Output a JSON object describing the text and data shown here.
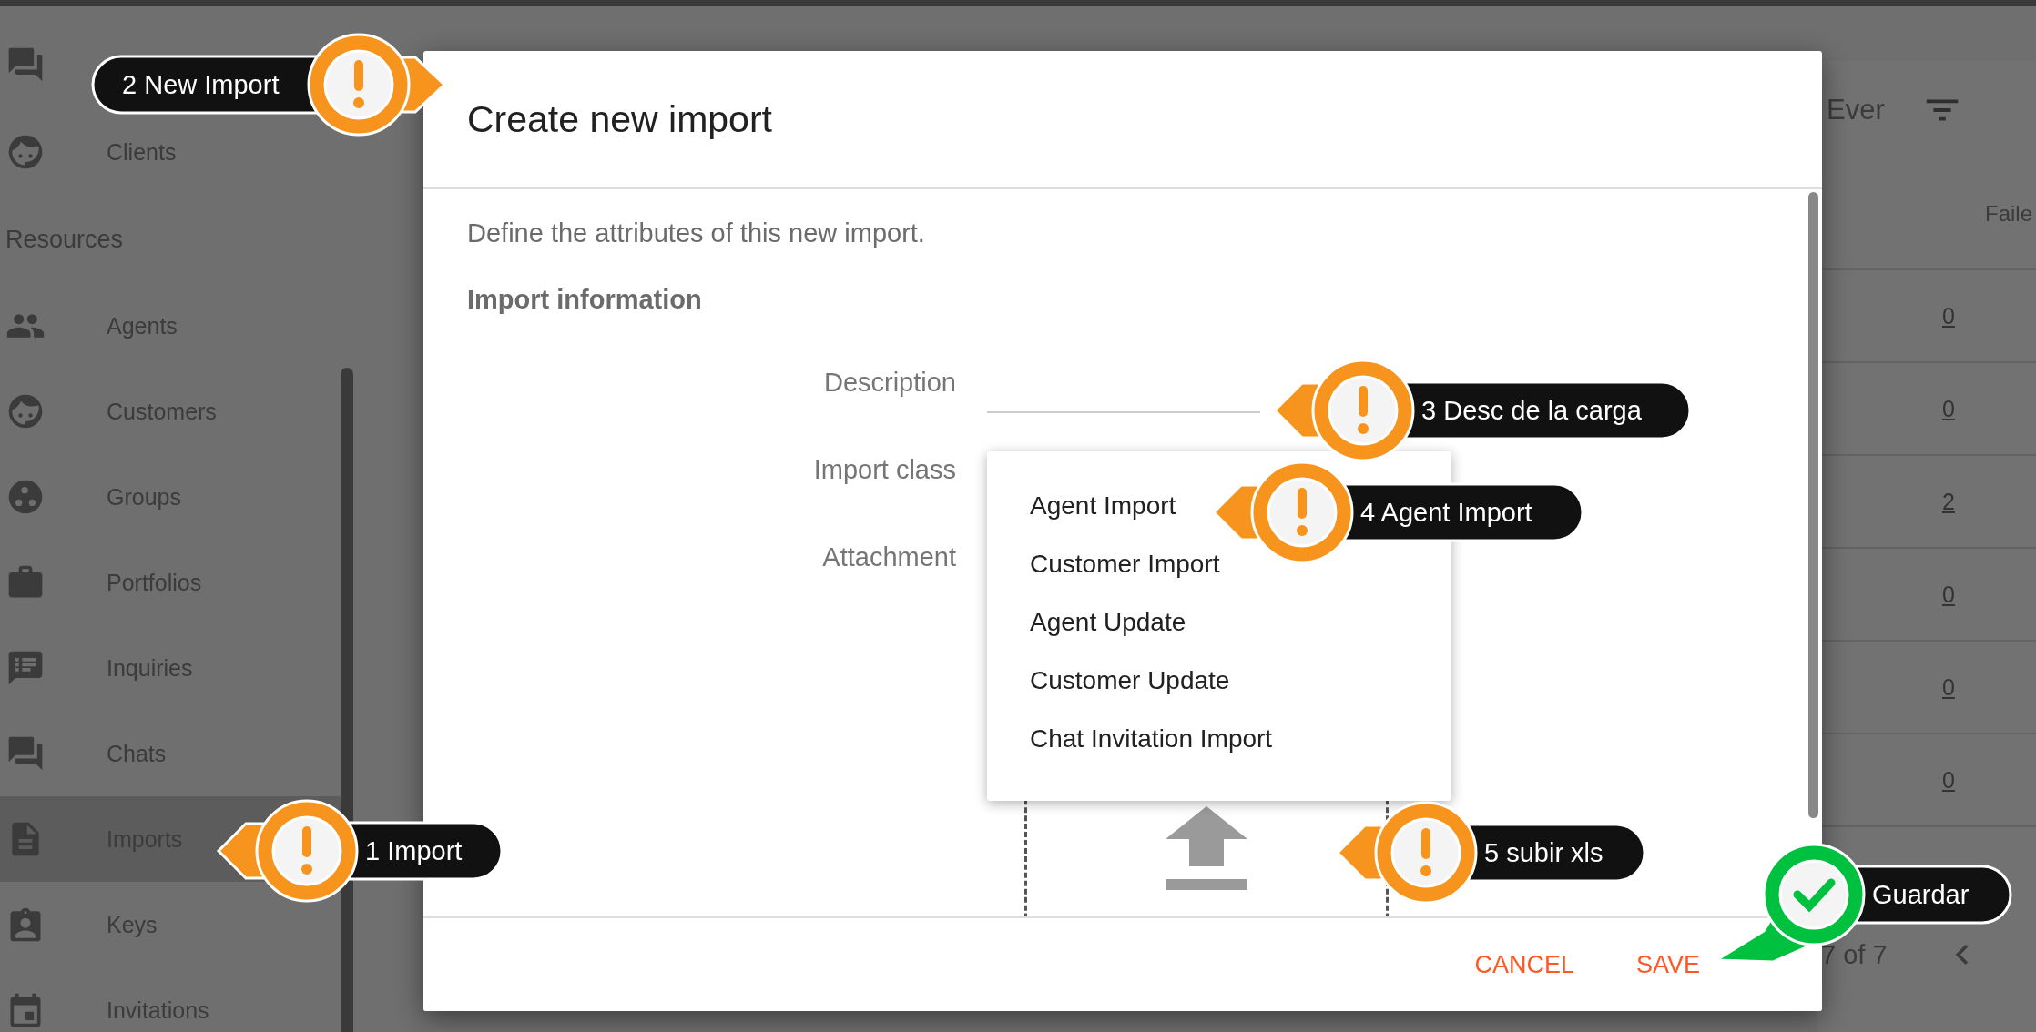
{
  "sidebar": {
    "top_items": [
      {
        "label": "Clients",
        "selected": false
      }
    ],
    "section_title": "Resources",
    "items": [
      {
        "label": "Agents",
        "selected": false
      },
      {
        "label": "Customers",
        "selected": false
      },
      {
        "label": "Groups",
        "selected": false
      },
      {
        "label": "Portfolios",
        "selected": false
      },
      {
        "label": "Inquiries",
        "selected": false
      },
      {
        "label": "Chats",
        "selected": false
      },
      {
        "label": "Imports",
        "selected": true
      },
      {
        "label": "Keys",
        "selected": false
      },
      {
        "label": "Invitations",
        "selected": false
      }
    ]
  },
  "background_table": {
    "period": "Ever",
    "column_header": "Faile",
    "values": [
      "0",
      "0",
      "2",
      "0",
      "0",
      "0"
    ],
    "pagination": "7 of 7"
  },
  "dialog": {
    "title": "Create new import",
    "intro": "Define the attributes of this new import.",
    "section": "Import information",
    "fields": [
      {
        "label": "Description",
        "kind": "text"
      },
      {
        "label": "Import class",
        "kind": "select"
      },
      {
        "label": "Attachment",
        "kind": "upload"
      }
    ],
    "import_class_options": [
      {
        "label": "Agent Import"
      },
      {
        "label": "Customer Import"
      },
      {
        "label": "Agent Update"
      },
      {
        "label": "Customer Update"
      },
      {
        "label": "Chat Invitation Import"
      }
    ],
    "buttons": [
      "CANCEL",
      "SAVE"
    ]
  },
  "callouts": [
    {
      "text": "1 Import",
      "kind": "warning"
    },
    {
      "text": "2 New Import",
      "kind": "warning"
    },
    {
      "text": "3 Desc de la carga",
      "kind": "warning"
    },
    {
      "text": "4 Agent Import",
      "kind": "warning"
    },
    {
      "text": "5 subir xls",
      "kind": "warning"
    },
    {
      "text": "Guardar",
      "kind": "check"
    }
  ]
}
